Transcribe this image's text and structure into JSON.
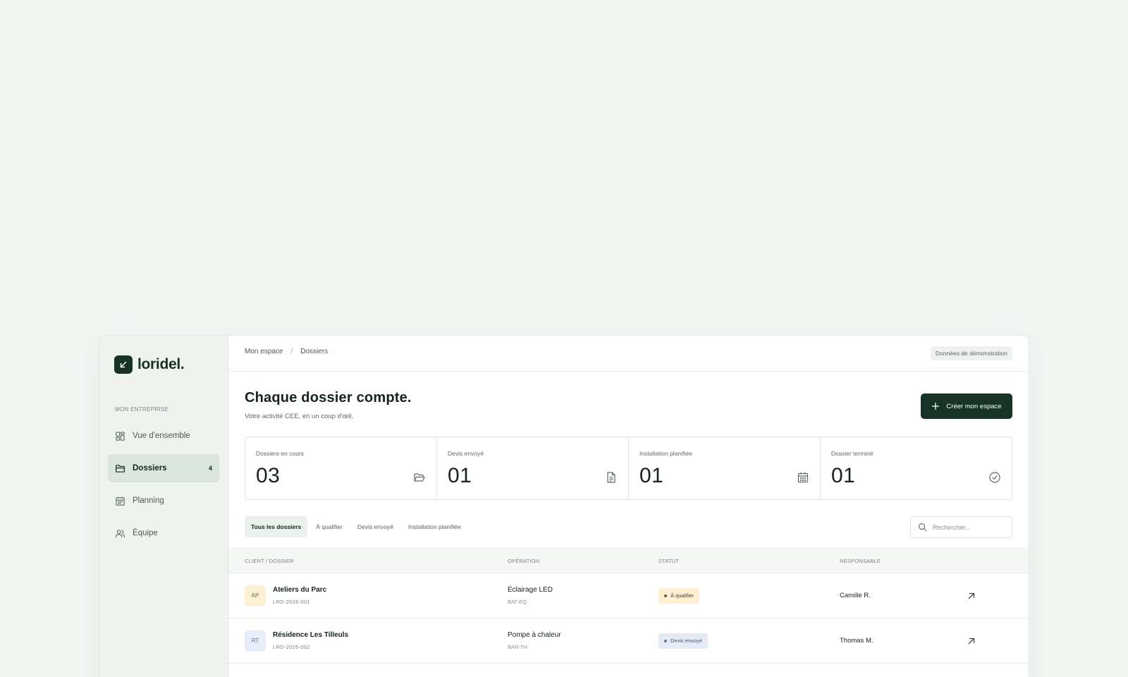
{
  "brand": {
    "name": "loridel."
  },
  "sidebar": {
    "section_label": "MON ENTREPRISE",
    "items": [
      {
        "label": "Vue d'ensemble",
        "icon": "dashboard-icon"
      },
      {
        "label": "Dossiers",
        "icon": "folder-icon",
        "count": "4",
        "active": true
      },
      {
        "label": "Planning",
        "icon": "calendar-icon"
      },
      {
        "label": "Équipe",
        "icon": "team-icon"
      }
    ]
  },
  "breadcrumb": {
    "root": "Mon espace",
    "separator": "/",
    "current": "Dossiers"
  },
  "demo_badge": "Données de démonstration",
  "header": {
    "title": "Chaque dossier compte.",
    "subtitle": "Votre activité CEE, en un coup d'œil.",
    "create_button": "Créer mon espace"
  },
  "stats": [
    {
      "label": "Dossiers en cours",
      "value": "03",
      "icon": "folder-open-icon"
    },
    {
      "label": "Devis envoyé",
      "value": "01",
      "icon": "document-icon"
    },
    {
      "label": "Installation planifiée",
      "value": "01",
      "icon": "calendar-icon"
    },
    {
      "label": "Dossier terminé",
      "value": "01",
      "icon": "check-circle-icon"
    }
  ],
  "filters": {
    "tabs": [
      "Tous les dossiers",
      "À qualifier",
      "Devis envoyé",
      "Installation planifiée"
    ],
    "active": "Tous les dossiers",
    "search_placeholder": "Rechercher..."
  },
  "table": {
    "columns": [
      "CLIENT / DOSSIER",
      "OPÉRATION",
      "STATUT",
      "RESPONSABLE"
    ],
    "rows": [
      {
        "initials": "AP",
        "client": "Ateliers du Parc",
        "ref": "LRD-2026-001",
        "operation": "Éclairage LED",
        "code": "BAT-EQ",
        "status": "À qualifier",
        "responsable": "Camille R."
      },
      {
        "initials": "RT",
        "client": "Résidence Les Tilleuls",
        "ref": "LRD-2026-002",
        "operation": "Pompe à chaleur",
        "code": "BAR-TH",
        "status": "Devis envoyé",
        "responsable": "Thomas M."
      }
    ]
  },
  "colors": {
    "brand_dark": "#173326",
    "sidebar_bg": "#eef3ef",
    "status_qualifier_bg": "#fcefd2",
    "status_qualifier_dot": "#6b5a3a",
    "status_devis_bg": "#e4ebf7",
    "status_devis_dot": "#6a7590",
    "avatar_ap_bg": "#fcefd2",
    "avatar_rt_bg": "#e6edf8"
  }
}
